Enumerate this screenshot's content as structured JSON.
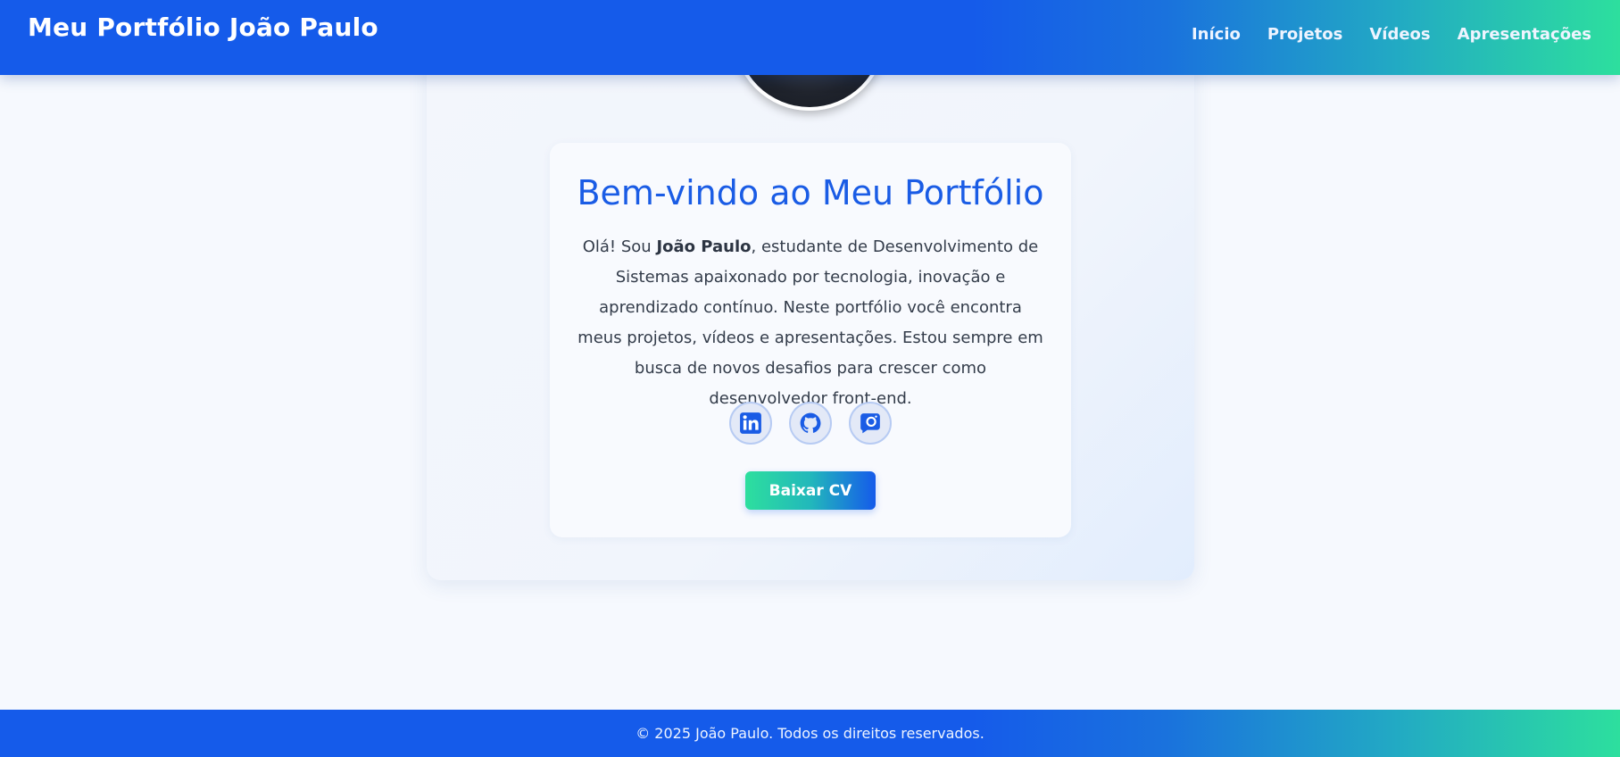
{
  "header": {
    "brand": "Meu Portfólio João Paulo",
    "nav": [
      {
        "label": "Início"
      },
      {
        "label": "Projetos"
      },
      {
        "label": "Vídeos"
      },
      {
        "label": "Apresentações"
      }
    ]
  },
  "hero": {
    "title": "Bem-vindo ao Meu Portfólio",
    "intro_prefix": "Olá! Sou ",
    "intro_name": "João Paulo",
    "intro_suffix": ", estudante de Desenvolvimento de Sistemas apaixonado por tecnologia, inovação e aprendizado contínuo. Neste portfólio você encontra meus projetos, vídeos e apresentações. Estou sempre em busca de novos desafios para crescer como desenvolvedor front-end.",
    "socials": [
      {
        "icon": "linkedin-icon"
      },
      {
        "icon": "github-icon"
      },
      {
        "icon": "instagram-icon"
      }
    ],
    "cv_button": "Baixar CV"
  },
  "footer": {
    "text": "© 2025 João Paulo. Todos os direitos reservados."
  },
  "colors": {
    "primary": "#155bea",
    "accent": "#2ddf9e",
    "title": "#1a5ce5"
  }
}
